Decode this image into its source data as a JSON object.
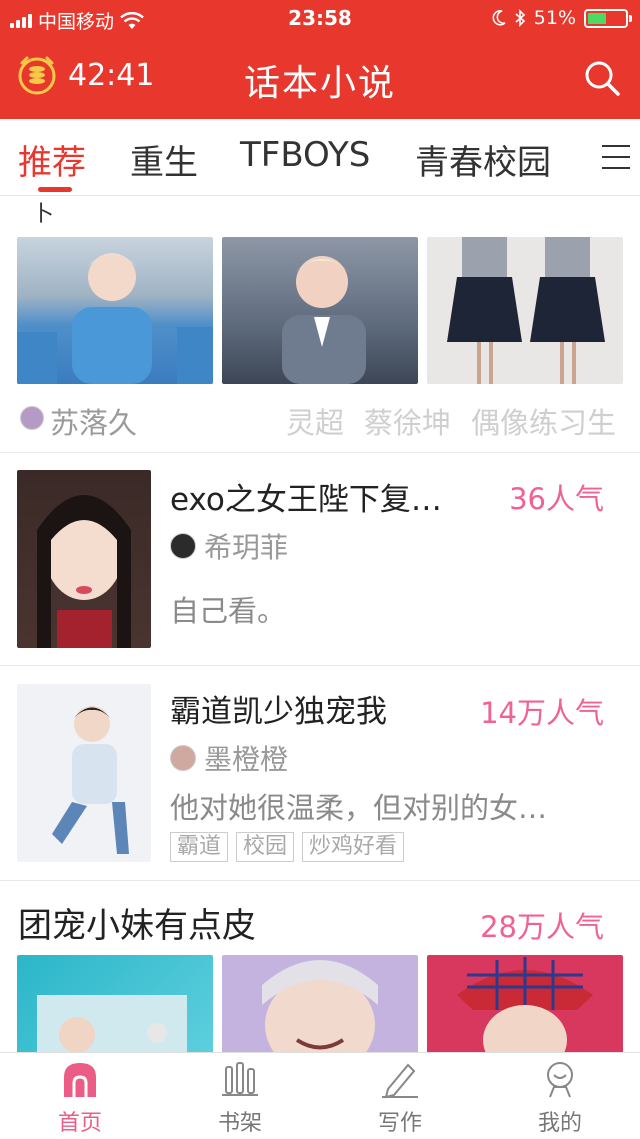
{
  "status_bar": {
    "carrier": "中国移动",
    "time": "23:58",
    "battery_percent": "51%",
    "battery_level": 0.51
  },
  "app_bar": {
    "timer": "42:41",
    "title": "话本小说"
  },
  "tabs": [
    {
      "label": "推荐",
      "active": true
    },
    {
      "label": "重生",
      "active": false
    },
    {
      "label": "TFBOYS",
      "active": false
    },
    {
      "label": "青春校园",
      "active": false
    }
  ],
  "feed": {
    "top_partial_glyph": "卜",
    "first_item": {
      "author": "苏落久",
      "tags": [
        "灵超",
        "蔡徐坤",
        "偶像练习生"
      ]
    },
    "books": [
      {
        "title": "exo之女王陛下复…",
        "popularity": "36人气",
        "author": "希玥菲",
        "description": "自己看。",
        "tags": []
      },
      {
        "title": "霸道凯少独宠我",
        "popularity": "14万人气",
        "author": "墨橙橙",
        "description": "他对她很温柔，但对别的女…",
        "tags": [
          "霸道",
          "校园",
          "炒鸡好看"
        ]
      },
      {
        "title": "团宠小妹有点皮",
        "popularity": "28万人气"
      }
    ]
  },
  "bottom_nav": [
    {
      "label": "首页",
      "icon": "home-icon",
      "active": true
    },
    {
      "label": "书架",
      "icon": "bookshelf-icon",
      "active": false
    },
    {
      "label": "写作",
      "icon": "pen-icon",
      "active": false
    },
    {
      "label": "我的",
      "icon": "profile-icon",
      "active": false
    }
  ],
  "colors": {
    "brand_red": "#e8382e",
    "popularity_pink": "#f06292",
    "nav_active_pink": "#ec5d86"
  }
}
